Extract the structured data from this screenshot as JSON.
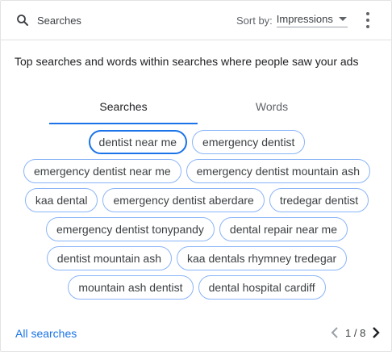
{
  "header": {
    "title": "Searches",
    "sort_label": "Sort by:",
    "sort_value": "Impressions"
  },
  "subtitle": "Top searches and words within searches where people saw your ads",
  "tabs": [
    {
      "label": "Searches",
      "active": true
    },
    {
      "label": "Words",
      "active": false
    }
  ],
  "chips": [
    [
      "dentist near me",
      "emergency dentist"
    ],
    [
      "emergency dentist near me",
      "emergency dentist mountain ash"
    ],
    [
      "kaa dental",
      "emergency dentist aberdare",
      "tredegar dentist"
    ],
    [
      "emergency dentist tonypandy",
      "dental repair near me"
    ],
    [
      "dentist mountain ash",
      "kaa dentals rhymney tredegar"
    ],
    [
      "mountain ash dentist",
      "dental hospital cardiff"
    ]
  ],
  "selected_chip": "dentist near me",
  "footer": {
    "all_searches": "All searches",
    "page_indicator": "1 / 8"
  },
  "colors": {
    "accent": "#1a73e8",
    "chip_border": "#8ab4f8"
  },
  "icons": {
    "search": "search-icon",
    "more": "more-vert-icon",
    "prev": "chevron-left-icon",
    "next": "chevron-right-icon"
  }
}
